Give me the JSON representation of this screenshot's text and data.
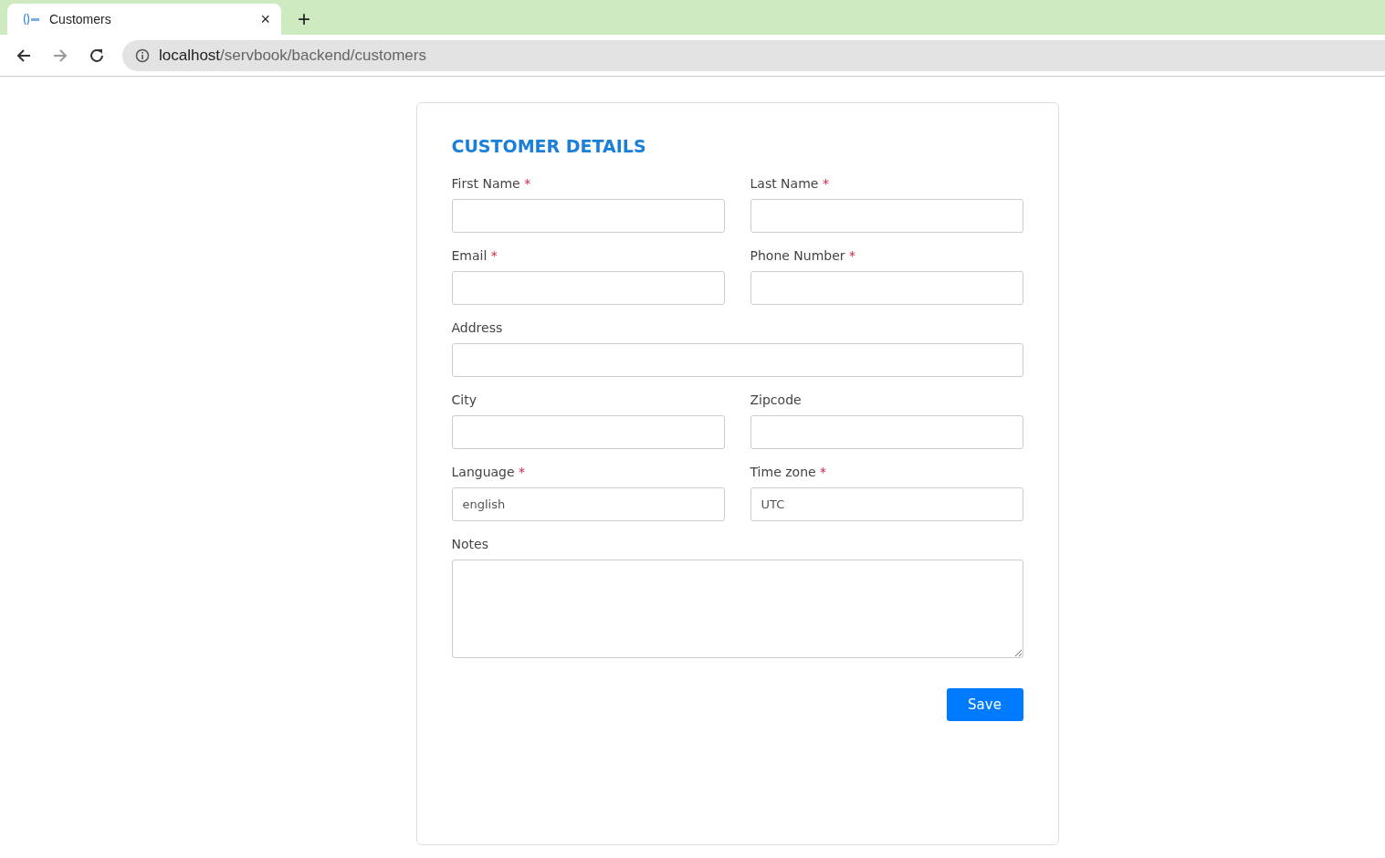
{
  "browser": {
    "tab": {
      "title": "Customers",
      "selected": true
    },
    "new_tab": "+",
    "close": "×",
    "url_host": "localhost",
    "url_path": "/servbook/backend/customers"
  },
  "form": {
    "title": "CUSTOMER DETAILS",
    "fields": [
      {
        "kind": "text",
        "label": "First Name",
        "required_mark": "*"
      },
      {
        "kind": "text",
        "label": "Last Name",
        "required_mark": "*"
      },
      {
        "kind": "text",
        "label": "Email",
        "required_mark": "*"
      },
      {
        "kind": "text",
        "label": "Phone Number",
        "required_mark": "*"
      },
      {
        "kind": "wide",
        "label": "Address"
      },
      {
        "kind": "text",
        "label": "City"
      },
      {
        "kind": "text",
        "label": "Zipcode"
      },
      {
        "kind": "text",
        "label": "Language",
        "required_mark": "*",
        "value": "english"
      },
      {
        "kind": "text",
        "label": "Time zone",
        "required_mark": "*",
        "value": "UTC"
      },
      {
        "kind": "textarea",
        "label": "Notes"
      }
    ],
    "save_button": "Save"
  }
}
